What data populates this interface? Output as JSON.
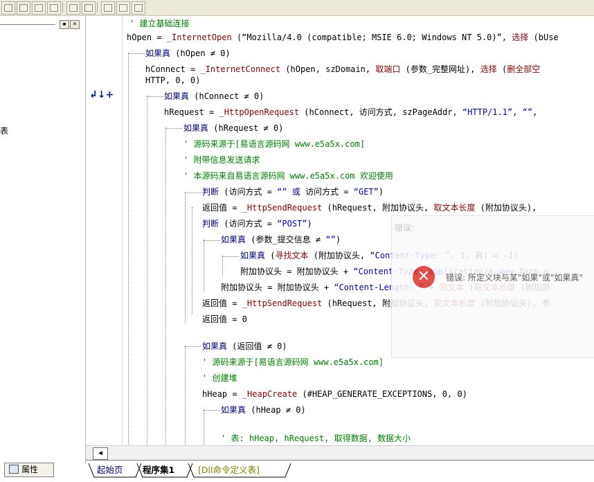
{
  "left_panel": {
    "stub_text": "表",
    "properties_tab_label": "属性",
    "close_glyph": "×"
  },
  "gutter": {
    "marker": "↲↓+"
  },
  "code_lines": [
    {
      "segs": [
        {
          "c": "cm",
          "t": "' 建立基础连接"
        }
      ]
    },
    {
      "segs": [
        {
          "c": "",
          "t": "hOpen = "
        },
        {
          "c": "fn",
          "t": "_InternetOpen"
        },
        {
          "c": "",
          "t": " (“Mozilla/4.0 (compatible; MSIE 6.0; Windows NT 5.0)”, "
        },
        {
          "c": "fn",
          "t": "选择"
        },
        {
          "c": "",
          "t": " (bUse"
        }
      ]
    },
    {
      "segs": [
        {
          "c": "kw",
          "t": "如果真"
        },
        {
          "c": "",
          "t": " (hOpen ≠ 0)"
        }
      ]
    },
    {
      "segs": [
        {
          "c": "",
          "t": "hConnect = "
        },
        {
          "c": "fn",
          "t": "_InternetConnect"
        },
        {
          "c": "",
          "t": " (hOpen, szDomain, "
        },
        {
          "c": "fn",
          "t": "取端口"
        },
        {
          "c": "",
          "t": " (参数_完整网址), "
        },
        {
          "c": "fn",
          "t": "选择"
        },
        {
          "c": "",
          "t": " ("
        },
        {
          "c": "fn",
          "t": "删全部空"
        }
      ]
    },
    {
      "segs": [
        {
          "c": "",
          "t": "HTTP, 0, 0)"
        }
      ]
    },
    {
      "segs": [
        {
          "c": "kw",
          "t": "如果真"
        },
        {
          "c": "",
          "t": " (hConnect ≠ 0)"
        }
      ]
    },
    {
      "segs": [
        {
          "c": "",
          "t": "hRequest = "
        },
        {
          "c": "fn",
          "t": "_HttpOpenRequest"
        },
        {
          "c": "",
          "t": " (hConnect, 访问方式, szPageAddr, "
        },
        {
          "c": "str",
          "t": "“HTTP/1.1”"
        },
        {
          "c": "",
          "t": ", "
        },
        {
          "c": "str",
          "t": "“”"
        },
        {
          "c": "",
          "t": ","
        }
      ]
    },
    {
      "segs": [
        {
          "c": "kw",
          "t": "如果真"
        },
        {
          "c": "",
          "t": " (hRequest ≠ 0)"
        }
      ]
    },
    {
      "segs": [
        {
          "c": "cm",
          "t": "' 源码来源于[易语言源码网 www.e5a5x.com]"
        }
      ]
    },
    {
      "segs": [
        {
          "c": "cm",
          "t": "' 附带信息发送请求"
        }
      ]
    },
    {
      "segs": [
        {
          "c": "cm",
          "t": "' 本源码来自易语言源码网 www.e5a5x.com  欢迎使用"
        }
      ]
    },
    {
      "segs": [
        {
          "c": "kw",
          "t": "判断"
        },
        {
          "c": "",
          "t": " (访问方式 = "
        },
        {
          "c": "str",
          "t": "“”"
        },
        {
          "c": "",
          "t": " "
        },
        {
          "c": "kw",
          "t": "或"
        },
        {
          "c": "",
          "t": " 访问方式 = "
        },
        {
          "c": "str",
          "t": "“GET”"
        },
        {
          "c": "",
          "t": ")"
        }
      ]
    },
    {
      "segs": [
        {
          "c": "",
          "t": "返回值 = "
        },
        {
          "c": "fn",
          "t": "_HttpSendRequest"
        },
        {
          "c": "",
          "t": " (hRequest, 附加协议头, "
        },
        {
          "c": "fn",
          "t": "取文本长度"
        },
        {
          "c": "",
          "t": " (附加协议头),"
        }
      ]
    },
    {
      "segs": [
        {
          "c": "kw",
          "t": "判断"
        },
        {
          "c": "",
          "t": " (访问方式 = "
        },
        {
          "c": "str",
          "t": "“POST”"
        },
        {
          "c": "",
          "t": ")"
        }
      ]
    },
    {
      "segs": [
        {
          "c": "kw",
          "t": "如果真"
        },
        {
          "c": "",
          "t": " (参数_提交信息 ≠ "
        },
        {
          "c": "str",
          "t": "“”"
        },
        {
          "c": "",
          "t": ")"
        }
      ]
    },
    {
      "segs": [
        {
          "c": "kw",
          "t": "如果真"
        },
        {
          "c": "",
          "t": " ("
        },
        {
          "c": "fn",
          "t": "寻找文本"
        },
        {
          "c": "",
          "t": " (附加协议头, "
        },
        {
          "c": "str",
          "t": "“Content-Type: ”"
        },
        {
          "c": "",
          "t": ", 1, 真) = -1)"
        }
      ]
    },
    {
      "segs": [
        {
          "c": "",
          "t": "附加协议头 = 附加协议头 + "
        },
        {
          "c": "str",
          "t": "“Content-Type: application/x-www-form-u"
        }
      ]
    },
    {
      "segs": [
        {
          "c": "",
          "t": "附加协议头 = 附加协议头 + "
        },
        {
          "c": "str",
          "t": "“Content-Length: ”"
        },
        {
          "c": "",
          "t": " + "
        },
        {
          "c": "fn",
          "t": "到文本"
        },
        {
          "c": "",
          "t": " ("
        },
        {
          "c": "fn",
          "t": "取文本长度"
        },
        {
          "c": "",
          "t": " (附加协"
        }
      ]
    },
    {
      "segs": [
        {
          "c": "",
          "t": "返回值 = "
        },
        {
          "c": "fn",
          "t": "_HttpSendRequest"
        },
        {
          "c": "",
          "t": " (hRequest, 附加协议头, "
        },
        {
          "c": "fn",
          "t": "取文本长度"
        },
        {
          "c": "",
          "t": " (附加协议头), 参"
        }
      ]
    },
    {
      "segs": [
        {
          "c": "",
          "t": "返回值 = 0"
        }
      ]
    },
    {
      "segs": [
        {
          "c": "kw",
          "t": "如果真"
        },
        {
          "c": "",
          "t": " (返回值 ≠ 0)"
        }
      ]
    },
    {
      "segs": [
        {
          "c": "cm",
          "t": "' 源码来源于[易语言源码网 www.e5a5x.com]"
        }
      ]
    },
    {
      "segs": [
        {
          "c": "cm",
          "t": "' 创建堆"
        }
      ]
    },
    {
      "segs": [
        {
          "c": "",
          "t": "hHeap = "
        },
        {
          "c": "fn",
          "t": "_HeapCreate"
        },
        {
          "c": "",
          "t": " (#HEAP_GENERATE_EXCEPTIONS, 0, 0)"
        }
      ]
    },
    {
      "segs": [
        {
          "c": "kw",
          "t": "如果真"
        },
        {
          "c": "",
          "t": " (hHeap ≠ 0)"
        }
      ]
    },
    {
      "segs": [
        {
          "c": "cm",
          "t": "' 表: hHeap, hRequest, 取得数据, 数据大小"
        }
      ]
    }
  ],
  "popup": {
    "title": "错误:",
    "message": "错误: 所定义块与某\"如果\"或\"如果真\"",
    "icon_glyph": "✕"
  },
  "scrollbar": {
    "left_arrow": "◀"
  },
  "tabs": [
    {
      "label": "起始页"
    },
    {
      "label": "程序集1"
    },
    {
      "label": "[Dll命令定义表]"
    }
  ],
  "colors": {
    "comment": "#008000",
    "keyword": "#000080",
    "function": "#8b0000",
    "string": "#0000c0",
    "error_icon": "#d9342b"
  }
}
